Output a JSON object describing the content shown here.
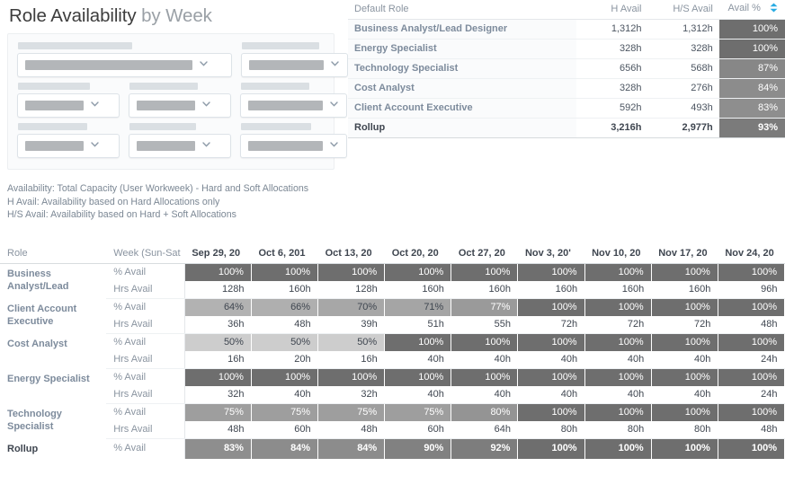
{
  "header": {
    "title_strong": "Role Availability",
    "title_light": " by Week"
  },
  "filters": {
    "note": "filter labels and selected values are visually redacted",
    "caret_icon": "chevron-down-icon",
    "rows": [
      [
        {
          "label_w": 127,
          "value_w": 186,
          "size": "wide"
        },
        {
          "label_w": 86,
          "value_w": 83,
          "size": "right"
        }
      ],
      [
        {
          "label_w": 80,
          "value_w": 65,
          "size": "half"
        },
        {
          "label_w": 76,
          "value_w": 65,
          "size": "half"
        },
        {
          "label_w": 76,
          "value_w": 83,
          "size": "right"
        }
      ],
      [
        {
          "label_w": 77,
          "value_w": 65,
          "size": "half"
        },
        {
          "label_w": 74,
          "value_w": 65,
          "size": "half"
        },
        {
          "label_w": 78,
          "value_w": 83,
          "size": "right"
        }
      ]
    ]
  },
  "legend": {
    "line1": "Availability: Total Capacity (User Workweek) - Hard and Soft Allocations",
    "line2": "H Avail: Availability based on Hard Allocations only",
    "line3": "H/S Avail: Availability based on Hard + Soft Allocations"
  },
  "summary": {
    "columns": {
      "role": "Default Role",
      "h_avail": "H Avail",
      "hs_avail": "H/S Avail",
      "avail_pct": "Avail %"
    },
    "sort_icon": "sort-both-arrows-icon",
    "sort_icon_color": "#29abe2",
    "rows": [
      {
        "role": "Business Analyst/Lead Designer",
        "h_avail": "1,312h",
        "hs_avail": "1,312h",
        "pct": "100%",
        "pct_value": 100
      },
      {
        "role": "Energy Specialist",
        "h_avail": "328h",
        "hs_avail": "328h",
        "pct": "100%",
        "pct_value": 100
      },
      {
        "role": "Technology Specialist",
        "h_avail": "656h",
        "hs_avail": "568h",
        "pct": "87%",
        "pct_value": 87
      },
      {
        "role": "Cost Analyst",
        "h_avail": "328h",
        "hs_avail": "276h",
        "pct": "84%",
        "pct_value": 84
      },
      {
        "role": "Client Account Executive",
        "h_avail": "592h",
        "hs_avail": "493h",
        "pct": "83%",
        "pct_value": 83
      }
    ],
    "rollup": {
      "role": "Rollup",
      "h_avail": "3,216h",
      "hs_avail": "2,977h",
      "pct": "93%",
      "pct_value": 93
    }
  },
  "detail": {
    "columns": {
      "role": "Role",
      "metric": "Week (Sun-Sat",
      "weeks": [
        "Sep 29, 20",
        "Oct 6, 201",
        "Oct 13, 20",
        "Oct 20, 20",
        "Oct 27, 20",
        "Nov 3, 20'",
        "Nov 10, 20",
        "Nov 17, 20",
        "Nov 24, 20"
      ]
    },
    "metric_labels": {
      "pct": "% Avail",
      "hrs": "Hrs Avail"
    },
    "groups": [
      {
        "role_line1": "Business",
        "role_line2": "Analyst/Lead",
        "pct": [
          "100%",
          "100%",
          "100%",
          "100%",
          "100%",
          "100%",
          "100%",
          "100%",
          "100%"
        ],
        "pctv": [
          100,
          100,
          100,
          100,
          100,
          100,
          100,
          100,
          100
        ],
        "hrs": [
          "128h",
          "160h",
          "128h",
          "160h",
          "160h",
          "160h",
          "160h",
          "160h",
          "96h"
        ]
      },
      {
        "role_line1": "Client Account",
        "role_line2": "Executive",
        "pct": [
          "64%",
          "66%",
          "70%",
          "71%",
          "77%",
          "100%",
          "100%",
          "100%",
          "100%"
        ],
        "pctv": [
          64,
          66,
          70,
          71,
          77,
          100,
          100,
          100,
          100
        ],
        "hrs": [
          "36h",
          "48h",
          "39h",
          "51h",
          "55h",
          "72h",
          "72h",
          "72h",
          "48h"
        ]
      },
      {
        "role_line1": "Cost Analyst",
        "role_line2": "",
        "pct": [
          "50%",
          "50%",
          "50%",
          "100%",
          "100%",
          "100%",
          "100%",
          "100%",
          "100%"
        ],
        "pctv": [
          50,
          50,
          50,
          100,
          100,
          100,
          100,
          100,
          100
        ],
        "hrs": [
          "16h",
          "20h",
          "16h",
          "40h",
          "40h",
          "40h",
          "40h",
          "40h",
          "24h"
        ]
      },
      {
        "role_line1": "Energy Specialist",
        "role_line2": "",
        "pct": [
          "100%",
          "100%",
          "100%",
          "100%",
          "100%",
          "100%",
          "100%",
          "100%",
          "100%"
        ],
        "pctv": [
          100,
          100,
          100,
          100,
          100,
          100,
          100,
          100,
          100
        ],
        "hrs": [
          "32h",
          "40h",
          "32h",
          "40h",
          "40h",
          "40h",
          "40h",
          "40h",
          "24h"
        ]
      },
      {
        "role_line1": "Technology",
        "role_line2": "Specialist",
        "pct": [
          "75%",
          "75%",
          "75%",
          "75%",
          "80%",
          "100%",
          "100%",
          "100%",
          "100%"
        ],
        "pctv": [
          75,
          75,
          75,
          75,
          80,
          100,
          100,
          100,
          100
        ],
        "hrs": [
          "48h",
          "60h",
          "48h",
          "60h",
          "64h",
          "80h",
          "80h",
          "80h",
          "48h"
        ]
      }
    ],
    "rollup": {
      "role_line1": "Rollup",
      "role_line2": "",
      "pct": [
        "83%",
        "84%",
        "84%",
        "90%",
        "92%",
        "100%",
        "100%",
        "100%",
        "100%"
      ],
      "pctv": [
        83,
        84,
        84,
        90,
        92,
        100,
        100,
        100,
        100
      ]
    }
  },
  "colors": {
    "heat_low": "#c9c9c9",
    "heat_high": "#6e6e6e",
    "accent": "#29abe2",
    "role_label": "#7d8b9c",
    "muted_text": "#8a94a0"
  }
}
